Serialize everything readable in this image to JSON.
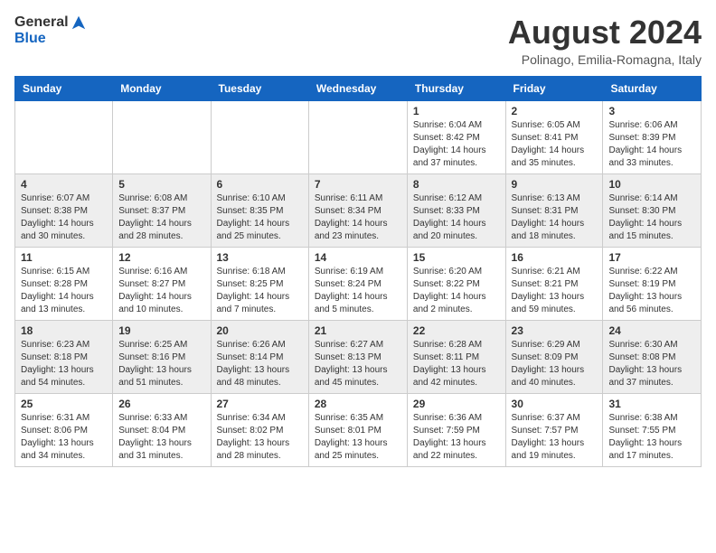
{
  "header": {
    "logo_general": "General",
    "logo_blue": "Blue",
    "month_title": "August 2024",
    "location": "Polinago, Emilia-Romagna, Italy"
  },
  "days_of_week": [
    "Sunday",
    "Monday",
    "Tuesday",
    "Wednesday",
    "Thursday",
    "Friday",
    "Saturday"
  ],
  "weeks": [
    [
      {
        "num": "",
        "info": ""
      },
      {
        "num": "",
        "info": ""
      },
      {
        "num": "",
        "info": ""
      },
      {
        "num": "",
        "info": ""
      },
      {
        "num": "1",
        "info": "Sunrise: 6:04 AM\nSunset: 8:42 PM\nDaylight: 14 hours\nand 37 minutes."
      },
      {
        "num": "2",
        "info": "Sunrise: 6:05 AM\nSunset: 8:41 PM\nDaylight: 14 hours\nand 35 minutes."
      },
      {
        "num": "3",
        "info": "Sunrise: 6:06 AM\nSunset: 8:39 PM\nDaylight: 14 hours\nand 33 minutes."
      }
    ],
    [
      {
        "num": "4",
        "info": "Sunrise: 6:07 AM\nSunset: 8:38 PM\nDaylight: 14 hours\nand 30 minutes."
      },
      {
        "num": "5",
        "info": "Sunrise: 6:08 AM\nSunset: 8:37 PM\nDaylight: 14 hours\nand 28 minutes."
      },
      {
        "num": "6",
        "info": "Sunrise: 6:10 AM\nSunset: 8:35 PM\nDaylight: 14 hours\nand 25 minutes."
      },
      {
        "num": "7",
        "info": "Sunrise: 6:11 AM\nSunset: 8:34 PM\nDaylight: 14 hours\nand 23 minutes."
      },
      {
        "num": "8",
        "info": "Sunrise: 6:12 AM\nSunset: 8:33 PM\nDaylight: 14 hours\nand 20 minutes."
      },
      {
        "num": "9",
        "info": "Sunrise: 6:13 AM\nSunset: 8:31 PM\nDaylight: 14 hours\nand 18 minutes."
      },
      {
        "num": "10",
        "info": "Sunrise: 6:14 AM\nSunset: 8:30 PM\nDaylight: 14 hours\nand 15 minutes."
      }
    ],
    [
      {
        "num": "11",
        "info": "Sunrise: 6:15 AM\nSunset: 8:28 PM\nDaylight: 14 hours\nand 13 minutes."
      },
      {
        "num": "12",
        "info": "Sunrise: 6:16 AM\nSunset: 8:27 PM\nDaylight: 14 hours\nand 10 minutes."
      },
      {
        "num": "13",
        "info": "Sunrise: 6:18 AM\nSunset: 8:25 PM\nDaylight: 14 hours\nand 7 minutes."
      },
      {
        "num": "14",
        "info": "Sunrise: 6:19 AM\nSunset: 8:24 PM\nDaylight: 14 hours\nand 5 minutes."
      },
      {
        "num": "15",
        "info": "Sunrise: 6:20 AM\nSunset: 8:22 PM\nDaylight: 14 hours\nand 2 minutes."
      },
      {
        "num": "16",
        "info": "Sunrise: 6:21 AM\nSunset: 8:21 PM\nDaylight: 13 hours\nand 59 minutes."
      },
      {
        "num": "17",
        "info": "Sunrise: 6:22 AM\nSunset: 8:19 PM\nDaylight: 13 hours\nand 56 minutes."
      }
    ],
    [
      {
        "num": "18",
        "info": "Sunrise: 6:23 AM\nSunset: 8:18 PM\nDaylight: 13 hours\nand 54 minutes."
      },
      {
        "num": "19",
        "info": "Sunrise: 6:25 AM\nSunset: 8:16 PM\nDaylight: 13 hours\nand 51 minutes."
      },
      {
        "num": "20",
        "info": "Sunrise: 6:26 AM\nSunset: 8:14 PM\nDaylight: 13 hours\nand 48 minutes."
      },
      {
        "num": "21",
        "info": "Sunrise: 6:27 AM\nSunset: 8:13 PM\nDaylight: 13 hours\nand 45 minutes."
      },
      {
        "num": "22",
        "info": "Sunrise: 6:28 AM\nSunset: 8:11 PM\nDaylight: 13 hours\nand 42 minutes."
      },
      {
        "num": "23",
        "info": "Sunrise: 6:29 AM\nSunset: 8:09 PM\nDaylight: 13 hours\nand 40 minutes."
      },
      {
        "num": "24",
        "info": "Sunrise: 6:30 AM\nSunset: 8:08 PM\nDaylight: 13 hours\nand 37 minutes."
      }
    ],
    [
      {
        "num": "25",
        "info": "Sunrise: 6:31 AM\nSunset: 8:06 PM\nDaylight: 13 hours\nand 34 minutes."
      },
      {
        "num": "26",
        "info": "Sunrise: 6:33 AM\nSunset: 8:04 PM\nDaylight: 13 hours\nand 31 minutes."
      },
      {
        "num": "27",
        "info": "Sunrise: 6:34 AM\nSunset: 8:02 PM\nDaylight: 13 hours\nand 28 minutes."
      },
      {
        "num": "28",
        "info": "Sunrise: 6:35 AM\nSunset: 8:01 PM\nDaylight: 13 hours\nand 25 minutes."
      },
      {
        "num": "29",
        "info": "Sunrise: 6:36 AM\nSunset: 7:59 PM\nDaylight: 13 hours\nand 22 minutes."
      },
      {
        "num": "30",
        "info": "Sunrise: 6:37 AM\nSunset: 7:57 PM\nDaylight: 13 hours\nand 19 minutes."
      },
      {
        "num": "31",
        "info": "Sunrise: 6:38 AM\nSunset: 7:55 PM\nDaylight: 13 hours\nand 17 minutes."
      }
    ]
  ]
}
